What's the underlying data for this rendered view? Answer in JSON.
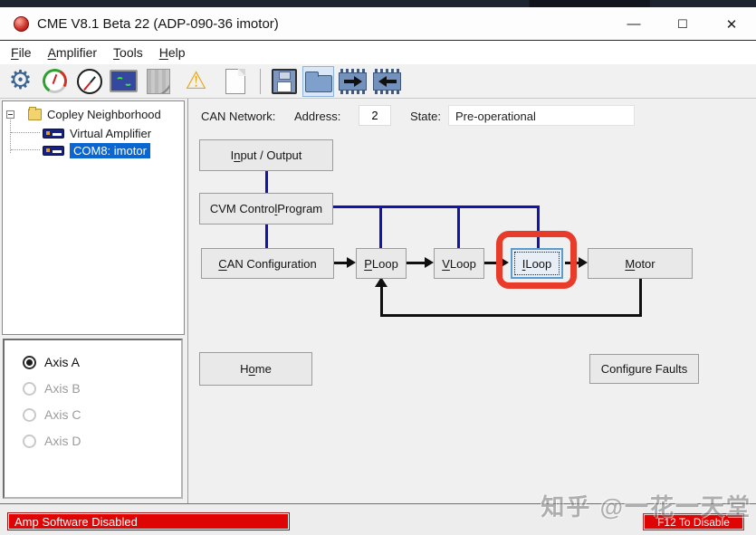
{
  "window": {
    "title": "CME V8.1 Beta 22 (ADP-090-36 imotor)",
    "controls": {
      "minimize": "—",
      "maximize": "☐",
      "close": "✕"
    }
  },
  "menu": {
    "items": [
      {
        "pre": "",
        "key": "F",
        "post": "ile"
      },
      {
        "pre": "",
        "key": "A",
        "post": "mplifier"
      },
      {
        "pre": "",
        "key": "T",
        "post": "ools"
      },
      {
        "pre": "",
        "key": "H",
        "post": "elp"
      }
    ]
  },
  "toolbar": {
    "icons": [
      "settings-gear",
      "gauge",
      "stopwatch",
      "oscilloscope",
      "curves-disabled",
      "warning",
      "document",
      "save",
      "open-folder-active",
      "chip-write",
      "chip-read"
    ]
  },
  "tree": {
    "root": "Copley Neighborhood",
    "items": [
      {
        "label": "Virtual Amplifier",
        "selected": false
      },
      {
        "label": "COM8: imotor",
        "selected": true
      }
    ]
  },
  "axis_panel": {
    "options": [
      {
        "label": "Axis A",
        "selected": true,
        "enabled": true
      },
      {
        "label": "Axis B",
        "selected": false,
        "enabled": false
      },
      {
        "label": "Axis C",
        "selected": false,
        "enabled": false
      },
      {
        "label": "Axis D",
        "selected": false,
        "enabled": false
      }
    ]
  },
  "can_bar": {
    "network_label": "CAN Network:",
    "address_label": "Address:",
    "address_value": "2",
    "state_label": "State:",
    "state_value": "Pre-operational"
  },
  "diagram": {
    "buttons": {
      "io": {
        "pre": "I",
        "key": "n",
        "post": "put / Output"
      },
      "cvm": {
        "pre": "CVM Contro",
        "key": "l",
        "post": " Program"
      },
      "can": {
        "pre": "",
        "key": "C",
        "post": "AN Configuration"
      },
      "ploop": {
        "pre": "",
        "key": "P",
        "post": " Loop"
      },
      "vloop": {
        "pre": "",
        "key": "V",
        "post": " Loop"
      },
      "iloop": {
        "pre": "",
        "key": "I",
        "post": " Loop"
      },
      "motor": {
        "pre": "",
        "key": "M",
        "post": "otor"
      },
      "home": {
        "pre": "H",
        "key": "o",
        "post": "me"
      },
      "faults": {
        "pre": "Confi",
        "key": "g",
        "post": "ure Faults"
      }
    }
  },
  "status_bar": {
    "left": "Amp Software Disabled",
    "right": "F12 To Disable"
  },
  "watermark": "知乎 @一花一天堂",
  "colors": {
    "tree_selection": "#0a66d0",
    "connector_blue": "#1216a8",
    "annotation_red": "#e93b2a",
    "status_red": "#e00505"
  }
}
